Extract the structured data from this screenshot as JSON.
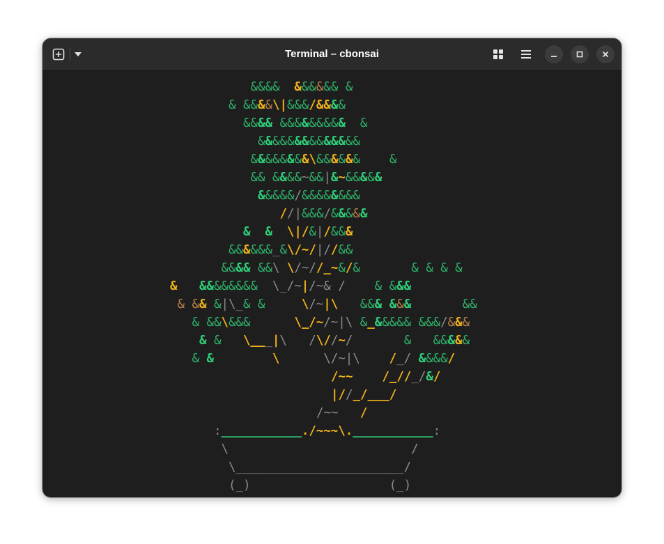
{
  "window": {
    "title": "Terminal – cbonsai",
    "icons": {
      "new_tab": "new-tab-plus-icon",
      "menu_dropdown": "chevron-down-icon",
      "tab_overview": "grid-icon",
      "main_menu": "hamburger-menu-icon",
      "minimize": "minimize-icon",
      "maximize": "maximize-icon",
      "close": "close-icon"
    }
  },
  "colors": {
    "leaf": "#2db36a",
    "leaf_bold": "#2fd07a",
    "trunk": "#e0a812",
    "trunk_bold": "#f0b21a",
    "trunk_dark": "#b88148",
    "pot": "#8c8c8c",
    "terminal_bg": "#1e1e1e"
  },
  "terminal": {
    "lines": [
      [
        [
          "g",
          "&&&&  "
        ],
        [
          "Y",
          "&"
        ],
        [
          "g",
          "&&"
        ],
        [
          "b",
          "&"
        ],
        [
          "g",
          "&& &"
        ]
      ],
      [
        [
          "g",
          "& &&"
        ],
        [
          "Y",
          "&"
        ],
        [
          "b",
          "&"
        ],
        [
          "Y",
          "\\|"
        ],
        [
          "g",
          "&&&"
        ],
        [
          "Y",
          "/&&"
        ],
        [
          "G",
          "&"
        ],
        [
          "g",
          "&"
        ]
      ],
      [
        [
          "g",
          "&&"
        ],
        [
          "G",
          "&&"
        ],
        [
          "g",
          " &&&"
        ],
        [
          "G",
          "&"
        ],
        [
          "g",
          "&&&&"
        ],
        [
          "G",
          "&"
        ],
        [
          "g",
          "  &"
        ]
      ],
      [
        [
          "g",
          "&"
        ],
        [
          "G",
          "&"
        ],
        [
          "g",
          "&&&"
        ],
        [
          "G",
          "&&"
        ],
        [
          "g",
          "&&"
        ],
        [
          "G",
          "&&&"
        ],
        [
          "g",
          "&&"
        ]
      ],
      [
        [
          "g",
          "&"
        ],
        [
          "G",
          "&"
        ],
        [
          "g",
          "&&&"
        ],
        [
          "G",
          "&"
        ],
        [
          "g",
          "&"
        ],
        [
          "Y",
          "&\\"
        ],
        [
          "g",
          "&&"
        ],
        [
          "Y",
          "&"
        ],
        [
          "g",
          "&"
        ],
        [
          "Y",
          "&"
        ],
        [
          "g",
          "&    &"
        ]
      ],
      [
        [
          "g",
          "&& &"
        ],
        [
          "G",
          "&"
        ],
        [
          "g",
          "&&"
        ],
        [
          "w",
          "~"
        ],
        [
          "g",
          "&&"
        ],
        [
          "w",
          "|"
        ],
        [
          "G",
          "&"
        ],
        [
          "Y",
          "~"
        ],
        [
          "g",
          "&&"
        ],
        [
          "G",
          "&"
        ],
        [
          "g",
          "&"
        ],
        [
          "G",
          "&"
        ]
      ],
      [
        [
          "G",
          "&"
        ],
        [
          "g",
          "&&&&"
        ],
        [
          "w",
          "/"
        ],
        [
          "g",
          "&&&&"
        ],
        [
          "G",
          "&"
        ],
        [
          "g",
          "&&&"
        ]
      ],
      [
        [
          "Y",
          "/"
        ],
        [
          "w",
          "/|"
        ],
        [
          "g",
          "&&&"
        ],
        [
          "w",
          "/"
        ],
        [
          "g",
          "&"
        ],
        [
          "G",
          "&"
        ],
        [
          "g",
          "&"
        ],
        [
          "b",
          "&"
        ],
        [
          "G",
          "&"
        ]
      ],
      [
        [
          "G",
          "&  &  "
        ],
        [
          "Y",
          "\\|/"
        ],
        [
          "g",
          "&"
        ],
        [
          "w",
          "|"
        ],
        [
          "Y",
          "/"
        ],
        [
          "g",
          "&&"
        ],
        [
          "Y",
          "&"
        ]
      ],
      [
        [
          "g",
          "&&"
        ],
        [
          "Y",
          "&"
        ],
        [
          "g",
          "&&&"
        ],
        [
          "w",
          "_"
        ],
        [
          "g",
          "&"
        ],
        [
          "Y",
          "\\/~/"
        ],
        [
          "w",
          "|/"
        ],
        [
          "Y",
          "/"
        ],
        [
          "g",
          "&&"
        ]
      ],
      [
        [
          "g",
          "&&"
        ],
        [
          "G",
          "&&"
        ],
        [
          "g",
          " &&"
        ],
        [
          "w",
          "\\ "
        ],
        [
          "Y",
          "\\"
        ],
        [
          "w",
          "/~/"
        ],
        [
          "Y",
          "/_~"
        ],
        [
          "g",
          "&"
        ],
        [
          "Y",
          "/"
        ],
        [
          "g",
          "&       & & & &"
        ]
      ],
      [
        [
          "Y",
          "&   "
        ],
        [
          "G",
          "&&"
        ],
        [
          "g",
          "&&&&&&  "
        ],
        [
          "w",
          "\\_/~"
        ],
        [
          "Y",
          "|"
        ],
        [
          "w",
          "/~& /    "
        ],
        [
          "g",
          "& &"
        ],
        [
          "G",
          "&&"
        ]
      ],
      [
        [
          "b",
          "& &"
        ],
        [
          "Y",
          "&"
        ],
        [
          "g",
          " &"
        ],
        [
          "w",
          "|\\_"
        ],
        [
          "g",
          "& &     "
        ],
        [
          "Y",
          "\\"
        ],
        [
          "w",
          "/~"
        ],
        [
          "Y",
          "|\\   "
        ],
        [
          "g",
          "&&"
        ],
        [
          "G",
          "& &"
        ],
        [
          "b",
          "&"
        ],
        [
          "G",
          "&"
        ],
        [
          "g",
          "       &&"
        ]
      ],
      [
        [
          "g",
          "& &&"
        ],
        [
          "Y",
          "\\"
        ],
        [
          "g",
          "&&&      "
        ],
        [
          "Y",
          "\\_/~"
        ],
        [
          "w",
          "/~|\\ "
        ],
        [
          "g",
          "&"
        ],
        [
          "Y",
          "_"
        ],
        [
          "G",
          "&"
        ],
        [
          "g",
          "&&&& &&&"
        ],
        [
          "w",
          "/"
        ],
        [
          "b",
          "&"
        ],
        [
          "Y",
          "&"
        ],
        [
          "b",
          "&"
        ]
      ],
      [
        [
          "G",
          "&"
        ],
        [
          "g",
          " &   "
        ],
        [
          "Y",
          "\\__"
        ],
        [
          "w",
          "_"
        ],
        [
          "Y",
          "|"
        ],
        [
          "w",
          "\\   /"
        ],
        [
          "Y",
          "\\/"
        ],
        [
          "w",
          "/"
        ],
        [
          "Y",
          "~"
        ],
        [
          "w",
          "/       "
        ],
        [
          "g",
          "&   &&"
        ],
        [
          "G",
          "&"
        ],
        [
          "Y",
          "&"
        ],
        [
          "g",
          "&"
        ]
      ],
      [
        [
          "g",
          "& "
        ],
        [
          "G",
          "&        "
        ],
        [
          "Y",
          "\\      "
        ],
        [
          "w",
          "\\/~|\\    "
        ],
        [
          "Y",
          "/"
        ],
        [
          "w",
          "_/ "
        ],
        [
          "G",
          "&"
        ],
        [
          "g",
          "&&&"
        ],
        [
          "Y",
          "/"
        ]
      ],
      [
        [
          "Y",
          "/~~    /_//"
        ],
        [
          "w",
          "_/"
        ],
        [
          "G",
          "&"
        ],
        [
          "Y",
          "/"
        ]
      ],
      [
        [
          "Y",
          "|/"
        ],
        [
          "w",
          "/"
        ],
        [
          "Y",
          "_/___/"
        ]
      ],
      [
        [
          "w",
          "/~~   "
        ],
        [
          "Y",
          "/"
        ]
      ],
      [
        [
          "w",
          ":"
        ],
        [
          "G",
          "___________"
        ],
        [
          "Y",
          "./~~~\\."
        ],
        [
          "G",
          "___________"
        ],
        [
          "w",
          ":"
        ]
      ],
      [
        [
          "w",
          "\\                         /"
        ]
      ],
      [
        [
          "w",
          " \\_______________________/"
        ]
      ],
      [
        [
          "w",
          " (_)                   (_)"
        ]
      ]
    ],
    "line_indent_cols": [
      27,
      24,
      26,
      28,
      27,
      27,
      28,
      31,
      26,
      24,
      23,
      16,
      17,
      19,
      20,
      19,
      38,
      38,
      36,
      22,
      23,
      23,
      23
    ]
  }
}
